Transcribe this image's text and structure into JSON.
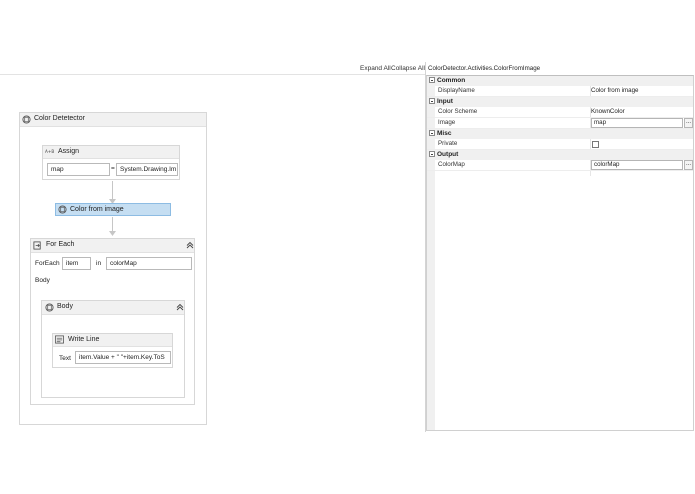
{
  "toolbar": {
    "expand_all": "Expand All",
    "collapse_all": "Collapse All"
  },
  "workflow": {
    "title": "Color Detetector",
    "assign": {
      "title": "Assign",
      "to_value": "map",
      "equals": "=",
      "value": "System.Drawing.Im"
    },
    "color_from_image": {
      "title": "Color from image"
    },
    "for_each": {
      "title": "For Each",
      "foreach_label": "ForEach",
      "item_value": "item",
      "in_label": "in",
      "collection_value": "colorMap",
      "body_label": "Body"
    },
    "body": {
      "title": "Body"
    },
    "write_line": {
      "title": "Write Line",
      "text_label": "Text",
      "text_value": "item.Value + \" \"+item.Key.ToS"
    }
  },
  "properties": {
    "title": "ColorDetector.Activities.ColorFromImage",
    "categories": [
      {
        "name": "Common",
        "rows": [
          {
            "name": "DisplayName",
            "value": "Color from image",
            "kind": "text"
          }
        ]
      },
      {
        "name": "Input",
        "rows": [
          {
            "name": "Color Scheme",
            "value": "KnownColor",
            "kind": "text"
          },
          {
            "name": "Image",
            "value": "map",
            "kind": "input"
          }
        ]
      },
      {
        "name": "Misc",
        "rows": [
          {
            "name": "Private",
            "value": "",
            "kind": "checkbox"
          }
        ]
      },
      {
        "name": "Output",
        "rows": [
          {
            "name": "ColorMap",
            "value": "colorMap",
            "kind": "input"
          }
        ]
      }
    ],
    "ellipsis": "..."
  }
}
